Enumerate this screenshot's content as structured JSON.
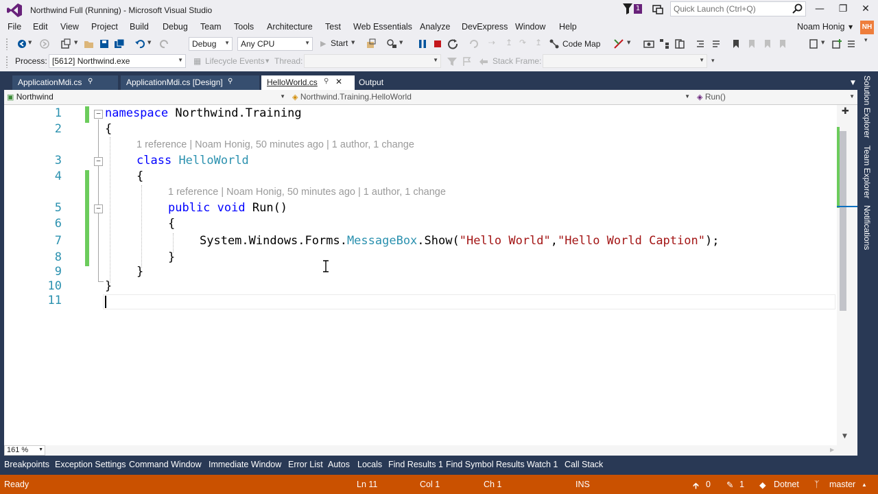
{
  "window": {
    "title": "Northwind Full (Running) - Microsoft Visual Studio",
    "notification_count": "1",
    "quick_launch_placeholder": "Quick Launch (Ctrl+Q)"
  },
  "menu": [
    "File",
    "Edit",
    "View",
    "Project",
    "Build",
    "Debug",
    "Team",
    "Tools",
    "Architecture",
    "Test",
    "Web Essentials",
    "Analyze",
    "DevExpress",
    "Window",
    "Help"
  ],
  "user": {
    "name": "Noam Honig",
    "initials": "NH"
  },
  "toolbar": {
    "configuration": "Debug",
    "platform": "Any CPU",
    "start_label": "Start",
    "code_map_label": "Code Map"
  },
  "debug_toolbar": {
    "process_label": "Process:",
    "process_value": "[5612] Northwind.exe",
    "lifecycle_label": "Lifecycle Events",
    "thread_label": "Thread:",
    "stack_frame_label": "Stack Frame:"
  },
  "tabs": [
    {
      "label": "ApplicationMdi.cs",
      "active": false
    },
    {
      "label": "ApplicationMdi.cs [Design]",
      "active": false
    },
    {
      "label": "HelloWorld.cs",
      "active": true
    },
    {
      "label": "Output",
      "active": false
    }
  ],
  "navbar": {
    "project": "Northwind",
    "type": "Northwind.Training.HelloWorld",
    "member": "Run()"
  },
  "editor": {
    "line_numbers": [
      "1",
      "2",
      "3",
      "4",
      "5",
      "6",
      "7",
      "8",
      "9",
      "10",
      "11"
    ],
    "lens_class": "1 reference | Noam Honig, 50 minutes ago | 1 author, 1 change",
    "lens_method": "1 reference | Noam Honig, 50 minutes ago | 1 author, 1 change",
    "line1": {
      "kw": "namespace",
      "name": " Northwind.Training"
    },
    "line2": "{",
    "line3": {
      "kw": "class",
      "name": "HelloWorld"
    },
    "line4": "{",
    "line5": {
      "kw1": "public",
      "kw2": "void",
      "name": " Run()"
    },
    "line6": "{",
    "line7": {
      "prefix": "System.Windows.Forms.",
      "type": "MessageBox",
      "call": ".Show(",
      "arg1": "\"Hello World\"",
      "comma": ",",
      "arg2": "\"Hello World Caption\"",
      "end": ");"
    },
    "line8": "}",
    "line9": "}",
    "line10": "}",
    "zoom": "161 %"
  },
  "side_tabs": [
    "Solution Explorer",
    "Team Explorer",
    "Notifications"
  ],
  "bottom_tabs": [
    "Breakpoints",
    "Exception Settings",
    "Command Window",
    "Immediate Window",
    "Error List",
    "Autos",
    "Locals",
    "Find Results 1",
    "Find Symbol Results",
    "Watch 1",
    "Call Stack"
  ],
  "status": {
    "state": "Ready",
    "ln": "Ln 11",
    "col": "Col 1",
    "ch": "Ch 1",
    "ins": "INS",
    "up_count": "0",
    "edit_count": "1",
    "repo": "Dotnet",
    "branch": "master"
  },
  "colors": {
    "status_bar": "#ca5100",
    "tab_well": "#293955",
    "change_marker": "#6ccc5c"
  }
}
